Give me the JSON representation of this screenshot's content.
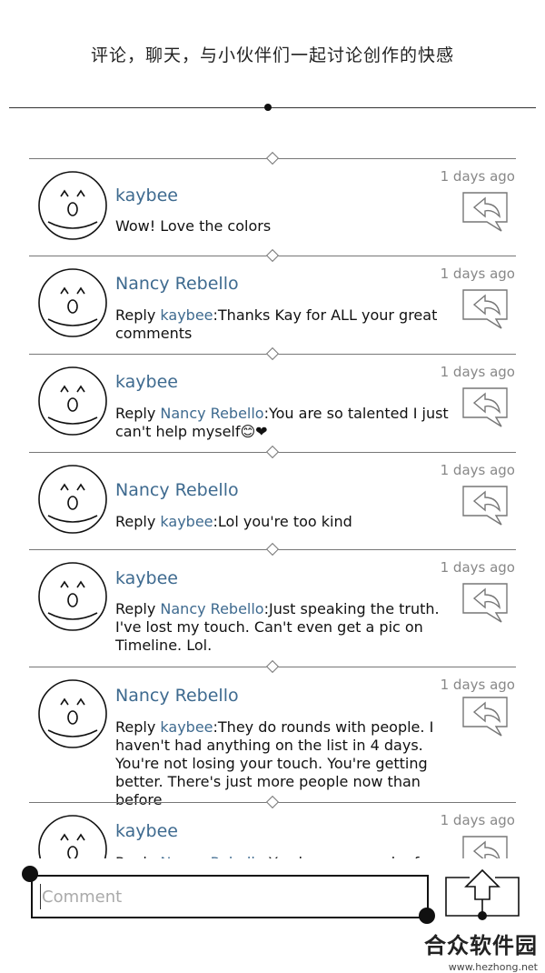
{
  "header": {
    "caption": "评论，聊天，与小伙伴们一起讨论创作的快感"
  },
  "comments": [
    {
      "author": "kaybee",
      "time": "1 days ago",
      "reply_prefix": "",
      "mention": "",
      "text": "Wow! Love the colors"
    },
    {
      "author": "Nancy Rebello",
      "time": "1 days ago",
      "reply_prefix": "Reply ",
      "mention": "kaybee",
      "text": ":Thanks Kay for ALL your great comments"
    },
    {
      "author": "kaybee",
      "time": "1 days ago",
      "reply_prefix": "Reply ",
      "mention": "Nancy Rebello",
      "text": ":You are so talented I just can't help myself😊❤"
    },
    {
      "author": "Nancy Rebello",
      "time": "1 days ago",
      "reply_prefix": "Reply ",
      "mention": "kaybee",
      "text": ":Lol you're too kind"
    },
    {
      "author": "kaybee",
      "time": "1 days ago",
      "reply_prefix": "Reply ",
      "mention": "Nancy Rebello",
      "text": ":Just speaking the truth. I've lost my touch. Can't even get a pic on Timeline. Lol."
    },
    {
      "author": "Nancy Rebello",
      "time": "1 days ago",
      "reply_prefix": "Reply ",
      "mention": "kaybee",
      "text": ":They do rounds with people. I haven't had anything on the list in 4 days. You're not losing your touch. You're getting better. There's just more people now than before"
    },
    {
      "author": "kaybee",
      "time": "1 days ago",
      "reply_prefix": "Reply ",
      "mention": "Nancy Rebello",
      "text": ":You have so much of a gift"
    }
  ],
  "composer": {
    "placeholder": "Comment"
  },
  "watermark": {
    "title": "合众软件园",
    "url": "www.hezhong.net"
  },
  "colors": {
    "accent_name": "#3e6a8f",
    "timestamp": "#888888",
    "separator": "#777777"
  },
  "icons": {
    "avatar": "surprised-face-avatar-icon",
    "reply": "reply-arrow-bubble-icon",
    "send": "upload-arrow-icon"
  }
}
